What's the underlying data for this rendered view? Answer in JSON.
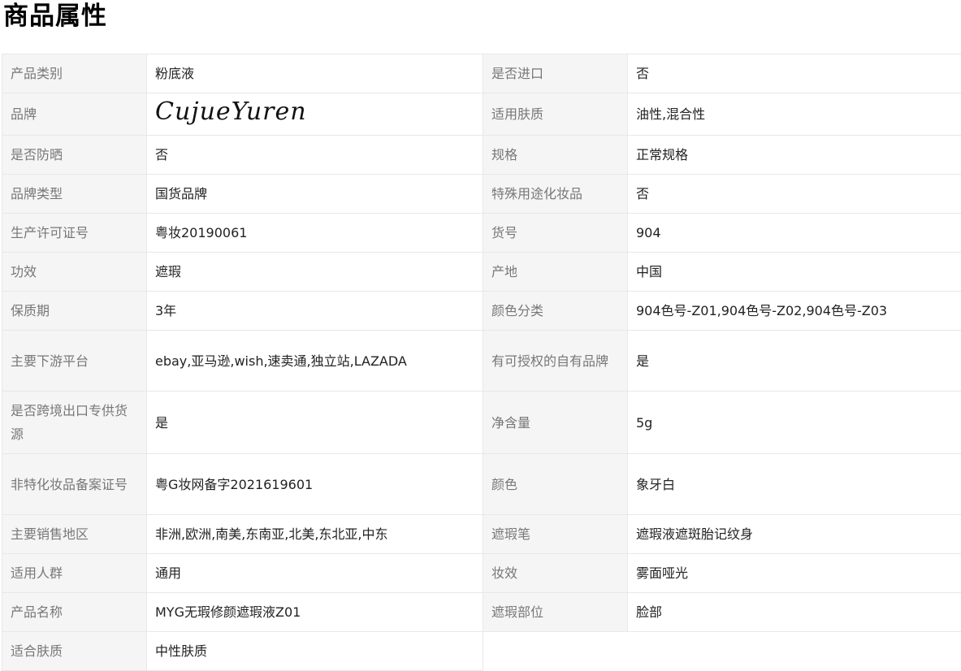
{
  "title": "商品属性",
  "rows": [
    {
      "k1": "产品类别",
      "v1": "粉底液",
      "k2": "是否进口",
      "v2": "否"
    },
    {
      "k1": "品牌",
      "v1": "CujueYuren",
      "k2": "适用肤质",
      "v2": "油性,混合性"
    },
    {
      "k1": "是否防晒",
      "v1": "否",
      "k2": "规格",
      "v2": "正常规格"
    },
    {
      "k1": "品牌类型",
      "v1": "国货品牌",
      "k2": "特殊用途化妆品",
      "v2": "否"
    },
    {
      "k1": "生产许可证号",
      "v1": "粤妆20190061",
      "k2": "货号",
      "v2": "904"
    },
    {
      "k1": "功效",
      "v1": "遮瑕",
      "k2": "产地",
      "v2": "中国"
    },
    {
      "k1": "保质期",
      "v1": "3年",
      "k2": "颜色分类",
      "v2": "904色号-Z01,904色号-Z02,904色号-Z03"
    },
    {
      "k1": "主要下游平台",
      "v1": "ebay,亚马逊,wish,速卖通,独立站,LAZADA",
      "k2": "有可授权的自有品牌",
      "v2": "是"
    },
    {
      "k1": "是否跨境出口专供货源",
      "v1": "是",
      "k2": "净含量",
      "v2": "5g"
    },
    {
      "k1": "非特化妆品备案证号",
      "v1": "粤G妆网备字2021619601",
      "k2": "颜色",
      "v2": "象牙白"
    },
    {
      "k1": "主要销售地区",
      "v1": "非洲,欧洲,南美,东南亚,北美,东北亚,中东",
      "k2": "遮瑕笔",
      "v2": "遮瑕液遮斑胎记纹身"
    },
    {
      "k1": "适用人群",
      "v1": "通用",
      "k2": "妆效",
      "v2": "雾面哑光"
    },
    {
      "k1": "产品名称",
      "v1": "MYG无瑕修颜遮瑕液Z01",
      "k2": "遮瑕部位",
      "v2": "脸部"
    },
    {
      "k1": "适合肤质",
      "v1": "中性肤质"
    }
  ]
}
